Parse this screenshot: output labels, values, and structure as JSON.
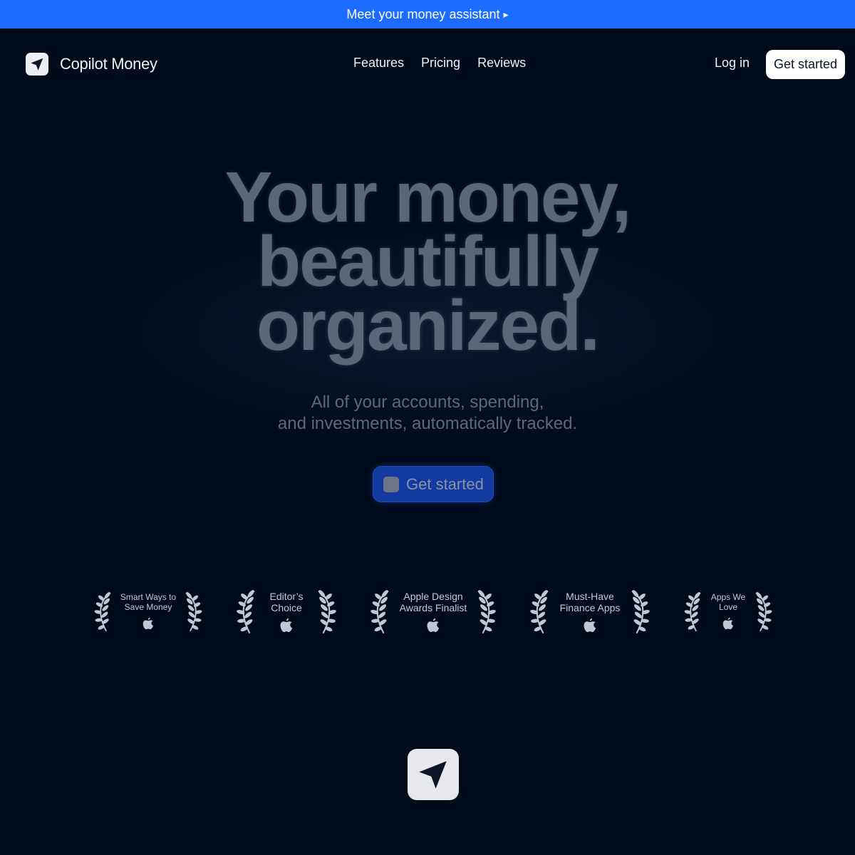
{
  "banner": {
    "text": "Meet your money assistant",
    "arrow": "▸"
  },
  "nav": {
    "brand": "Copilot Money",
    "links": [
      "Features",
      "Pricing",
      "Reviews"
    ],
    "login": "Log in",
    "cta": "Get started"
  },
  "hero": {
    "headline": [
      "Your money,",
      "beautifully",
      "organized."
    ],
    "subtitle": [
      "All of your accounts, spending,",
      "and investments, automatically tracked."
    ],
    "cta": "Get started"
  },
  "awards": [
    {
      "lines": [
        "Smart Ways to",
        "Save Money"
      ]
    },
    {
      "lines": [
        "Editor’s",
        "Choice"
      ]
    },
    {
      "lines": [
        "Apple Design",
        "Awards Finalist"
      ]
    },
    {
      "lines": [
        "Must-Have",
        "Finance Apps"
      ]
    },
    {
      "lines": [
        "Apps We",
        "Love"
      ]
    }
  ],
  "colors": {
    "banner": "#1c6cff",
    "background": "#010b1a",
    "hero_cta": "#123aa0"
  },
  "icons": {
    "brand": "paper-plane-icon",
    "award_left": "laurel-left-icon",
    "award_right": "laurel-right-icon",
    "award_badge": "apple-icon"
  }
}
